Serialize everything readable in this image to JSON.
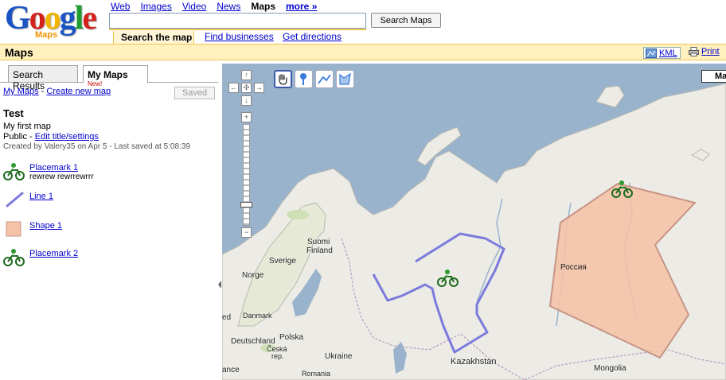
{
  "logo": {
    "text_g1": "G",
    "text_o1": "o",
    "text_o2": "o",
    "text_g2": "g",
    "text_l": "l",
    "text_e": "e",
    "sub": "Maps"
  },
  "nav": {
    "web": "Web",
    "images": "Images",
    "video": "Video",
    "news": "News",
    "maps": "Maps",
    "more": "more »"
  },
  "search": {
    "value": "",
    "button": "Search Maps"
  },
  "subtabs": {
    "search_map": "Search the map",
    "find_businesses": "Find businesses",
    "directions": "Get directions"
  },
  "bar": {
    "title": "Maps",
    "kml": "KML",
    "print": "Print"
  },
  "panel": {
    "tab_search": "Search Results",
    "tab_my": "My Maps",
    "tab_new": "New!",
    "my_maps_link": "My Maps",
    "sep": " - ",
    "create_link": "Create new map",
    "saved_button": "Saved",
    "map_title": "Test",
    "map_desc": "My first map",
    "privacy": "Public",
    "privacy_sep": " - ",
    "edit_link": "Edit title/settings",
    "created": "Created by Valery35 on Apr 5 - Last saved at 5:08:39",
    "items": [
      {
        "label": "Placemark 1",
        "desc": "rewrew rewrrewrrr"
      },
      {
        "label": "Line 1",
        "desc": ""
      },
      {
        "label": "Shape 1",
        "desc": ""
      },
      {
        "label": "Placemark 2",
        "desc": ""
      }
    ]
  },
  "map": {
    "type_button": "Ma",
    "labels": {
      "suomi": "Suomi",
      "finland": "Finland",
      "sverige": "Sverige",
      "norge": "Norge",
      "danmark": "Danmark",
      "ed": "ed",
      "deutschland": "Deutschland",
      "polska": "Polska",
      "ceska": "Česká",
      "rep": "rep.",
      "ukraine": "Ukraine",
      "romania": "Romania",
      "ance": "ance",
      "kazakhstan": "Kazakhstan",
      "mongolia": "Mongolia",
      "russia": "Россия"
    }
  },
  "colors": {
    "line": "#7b7bdc",
    "shape_fill": "#f6c2a6",
    "shape_stroke": "#c69486",
    "accent": "#f2c34f",
    "bar_bg": "#fff0bd"
  }
}
